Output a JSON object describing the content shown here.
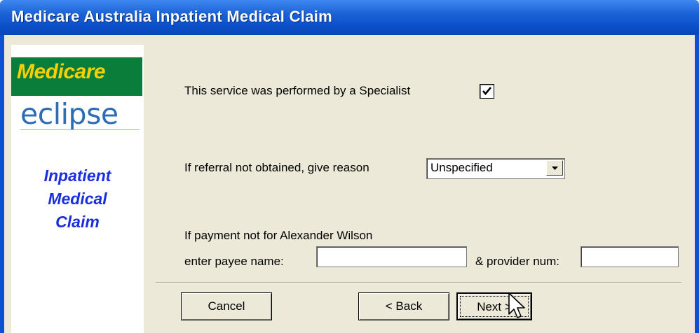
{
  "window": {
    "title": "Medicare Australia Inpatient Medical Claim"
  },
  "sidebar": {
    "medicare_logo": "Medicare",
    "eclipse_logo": "eclipse",
    "caption_lines": [
      "Inpatient",
      "Medical",
      "Claim"
    ]
  },
  "form": {
    "specialist_label": "This service was performed by a Specialist",
    "specialist_checked": true,
    "referral_label": "If referral not obtained, give reason",
    "referral_value": "Unspecified",
    "payment_label": "If payment not for Alexander Wilson",
    "payee_label": "enter payee name:",
    "payee_value": "",
    "provider_label": "& provider num:",
    "provider_value": ""
  },
  "buttons": {
    "cancel": "Cancel",
    "back": "< Back",
    "next": "Next >"
  },
  "colors": {
    "title_bar": "#0a4fc9",
    "medicare_green": "#0a7d3a",
    "medicare_yellow": "#f8cf00",
    "caption_blue": "#1a2ee0",
    "dialog_bg": "#ece9d8"
  }
}
